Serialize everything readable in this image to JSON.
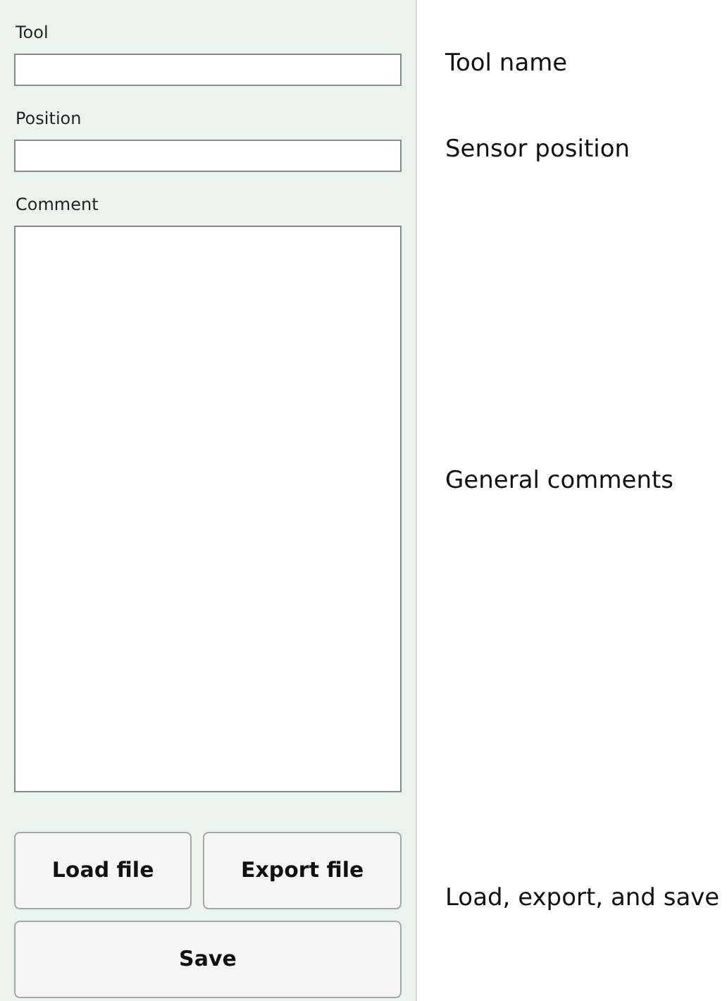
{
  "fields": [
    {
      "label": "Tool",
      "kind": "input",
      "annotation": "Tool name"
    },
    {
      "label": "Position",
      "kind": "input",
      "annotation": "Sensor position"
    },
    {
      "label": "Comment",
      "kind": "textarea",
      "annotation": "General comments"
    }
  ],
  "button_rows": [
    [
      "Load file",
      "Export file"
    ],
    [
      "Save"
    ]
  ],
  "buttons_annotation": "Load, export, and save"
}
